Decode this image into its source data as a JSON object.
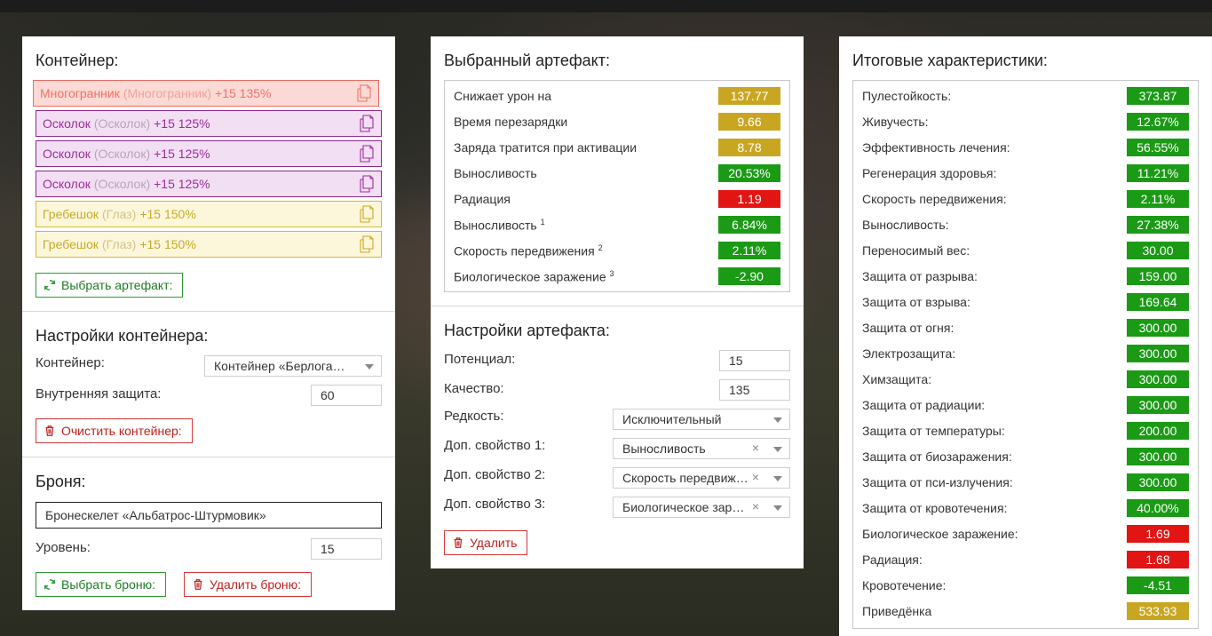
{
  "left": {
    "container_title": "Контейнер:",
    "slots": [
      {
        "name": "Многогранник",
        "sub": "(Многогранник)",
        "bonus": "+15 135%",
        "color": "red"
      },
      {
        "name": "Осколок",
        "sub": "(Осколок)",
        "bonus": "+15 125%",
        "color": "purple"
      },
      {
        "name": "Осколок",
        "sub": "(Осколок)",
        "bonus": "+15 125%",
        "color": "purple"
      },
      {
        "name": "Осколок",
        "sub": "(Осколок)",
        "bonus": "+15 125%",
        "color": "purple"
      },
      {
        "name": "Гребешок",
        "sub": "(Глаз)",
        "bonus": "+15 150%",
        "color": "yellow"
      },
      {
        "name": "Гребешок",
        "sub": "(Глаз)",
        "bonus": "+15 150%",
        "color": "yellow"
      }
    ],
    "choose_artifact_label": "Выбрать артефакт:",
    "settings_title": "Настройки контейнера:",
    "container_label": "Контейнер:",
    "container_value": "Контейнер «Берлога…",
    "inner_protection_label": "Внутренняя защита:",
    "inner_protection_value": "60",
    "clear_container_label": "Очистить контейнер:",
    "armor_title": "Броня:",
    "armor_value": "Бронескелет «Альбатрос-Штурмовик»",
    "level_label": "Уровень:",
    "level_value": "15",
    "choose_armor_label": "Выбрать броню:",
    "delete_armor_label": "Удалить броню:"
  },
  "middle": {
    "selected_title": "Выбранный артефакт:",
    "stats": [
      {
        "name": "Снижает урон на",
        "sup": "",
        "value": "137.77",
        "color": "gold"
      },
      {
        "name": "Время перезарядки",
        "sup": "",
        "value": "9.66",
        "color": "gold"
      },
      {
        "name": "Заряда тратится при активации",
        "sup": "",
        "value": "8.78",
        "color": "gold"
      },
      {
        "name": "Выносливость",
        "sup": "",
        "value": "20.53%",
        "color": "green"
      },
      {
        "name": "Радиация",
        "sup": "",
        "value": "1.19",
        "color": "red"
      },
      {
        "name": "Выносливость",
        "sup": "1",
        "value": "6.84%",
        "color": "green"
      },
      {
        "name": "Скорость передвижения",
        "sup": "2",
        "value": "2.11%",
        "color": "green"
      },
      {
        "name": "Биологическое заражение",
        "sup": "3",
        "value": "-2.90",
        "color": "green"
      }
    ],
    "settings_title": "Настройки артефакта:",
    "potential_label": "Потенциал:",
    "potential_value": "15",
    "quality_label": "Качество:",
    "quality_value": "135",
    "rarity_label": "Редкость:",
    "rarity_value": "Исключительный",
    "extra1_label": "Доп. свойство 1:",
    "extra1_value": "Выносливость",
    "extra2_label": "Доп. свойство 2:",
    "extra2_value": "Скорость передвижения",
    "extra3_label": "Доп. свойство 3:",
    "extra3_value": "Биологическое заражение",
    "clear_symbol": "×",
    "delete_label": "Удалить"
  },
  "right": {
    "title": "Итоговые характеристики:",
    "stats": [
      {
        "name": "Пулестойкость:",
        "value": "373.87",
        "color": "green"
      },
      {
        "name": "Живучесть:",
        "value": "12.67%",
        "color": "green"
      },
      {
        "name": "Эффективность лечения:",
        "value": "56.55%",
        "color": "green"
      },
      {
        "name": "Регенерация здоровья:",
        "value": "11.21%",
        "color": "green"
      },
      {
        "name": "Скорость передвижения:",
        "value": "2.11%",
        "color": "green"
      },
      {
        "name": "Выносливость:",
        "value": "27.38%",
        "color": "green"
      },
      {
        "name": "Переносимый вес:",
        "value": "30.00",
        "color": "green"
      },
      {
        "name": "Защита от разрыва:",
        "value": "159.00",
        "color": "green"
      },
      {
        "name": "Защита от взрыва:",
        "value": "169.64",
        "color": "green"
      },
      {
        "name": "Защита от огня:",
        "value": "300.00",
        "color": "green"
      },
      {
        "name": "Электрозащита:",
        "value": "300.00",
        "color": "green"
      },
      {
        "name": "Химзащита:",
        "value": "300.00",
        "color": "green"
      },
      {
        "name": "Защита от радиации:",
        "value": "300.00",
        "color": "green"
      },
      {
        "name": "Защита от температуры:",
        "value": "200.00",
        "color": "green"
      },
      {
        "name": "Защита от биозаражения:",
        "value": "300.00",
        "color": "green"
      },
      {
        "name": "Защита от пси-излучения:",
        "value": "300.00",
        "color": "green"
      },
      {
        "name": "Защита от кровотечения:",
        "value": "40.00%",
        "color": "green"
      },
      {
        "name": "Биологическое заражение:",
        "value": "1.69",
        "color": "red"
      },
      {
        "name": "Радиация:",
        "value": "1.68",
        "color": "red"
      },
      {
        "name": "Кровотечение:",
        "value": "-4.51",
        "color": "green"
      },
      {
        "name": "Приведёнка",
        "value": "533.93",
        "color": "gold"
      }
    ]
  },
  "colors": {
    "green": "#1b9a16",
    "gold": "#c9a621",
    "red": "#e21414"
  },
  "icons": [
    "copy-icon",
    "refresh-icon",
    "trash-icon",
    "chevron-down-icon",
    "clear-icon"
  ]
}
